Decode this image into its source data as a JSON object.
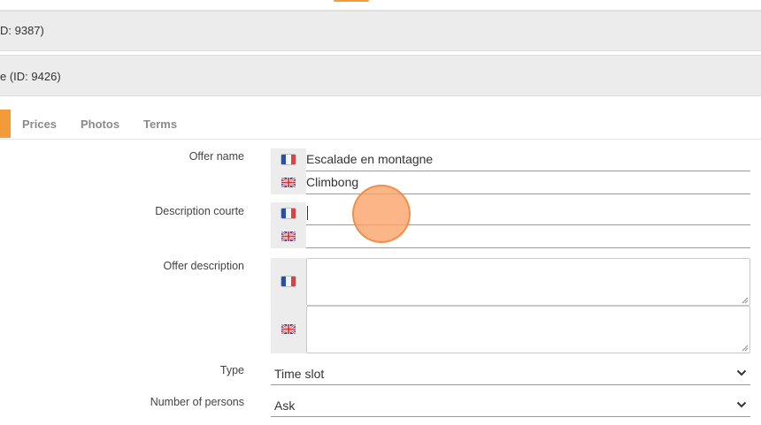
{
  "header": {
    "item1_text": "D: 9387)",
    "item2_text": "e (ID: 9426)"
  },
  "tabs": [
    {
      "label": "Prices"
    },
    {
      "label": "Photos"
    },
    {
      "label": "Terms"
    }
  ],
  "form": {
    "offer_name": {
      "label": "Offer name",
      "fr_value": "Escalade en montagne",
      "en_value": "Climbong"
    },
    "short_description": {
      "label": "Description courte",
      "fr_value": "",
      "en_value": ""
    },
    "offer_description": {
      "label": "Offer description",
      "fr_value": "",
      "en_value": ""
    },
    "type": {
      "label": "Type",
      "selected": "Time slot"
    },
    "number_of_persons": {
      "label": "Number of persons",
      "selected": "Ask"
    }
  },
  "colors": {
    "accent": "#f39a3a",
    "bar_bg": "#ececec"
  },
  "icons": {
    "french_flag": "flag-fr-icon",
    "uk_flag": "flag-uk-icon",
    "dropdown": "chevron-down-icon"
  }
}
